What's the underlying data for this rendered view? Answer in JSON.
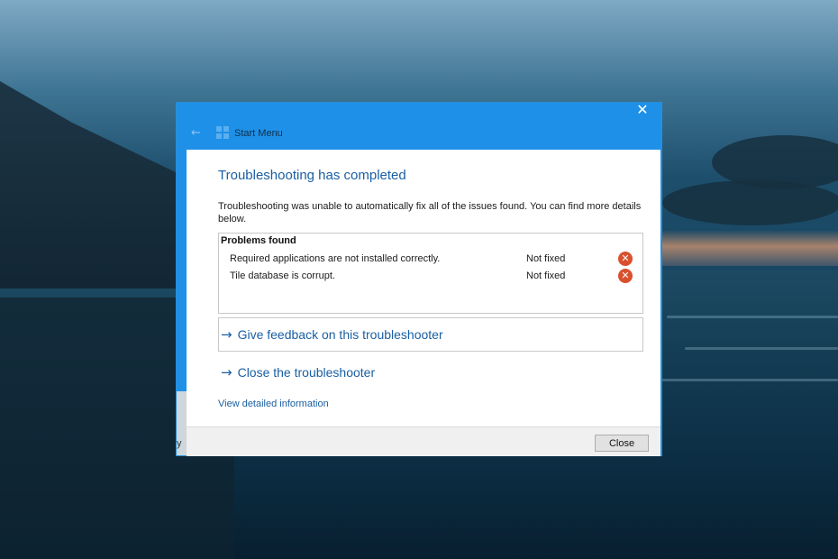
{
  "window": {
    "title": "Start Menu",
    "close_glyph": "✕",
    "back_glyph": "←",
    "heading": "Troubleshooting has completed",
    "description": "Troubleshooting was unable to automatically fix all of the issues found. You can find more details below.",
    "problems_title": "Problems found",
    "problems": [
      {
        "text": "Required applications are not installed correctly.",
        "status": "Not fixed",
        "icon": "error-icon"
      },
      {
        "text": "Tile database is corrupt.",
        "status": "Not fixed",
        "icon": "error-icon"
      }
    ],
    "feedback_link": "Give feedback on this troubleshooter",
    "close_link": "Close the troubleshooter",
    "detail_link": "View detailed information",
    "close_button": "Close",
    "side_text": "y"
  },
  "colors": {
    "accent": "#1e90e8",
    "link": "#1a5fa3",
    "error": "#d9502e"
  }
}
